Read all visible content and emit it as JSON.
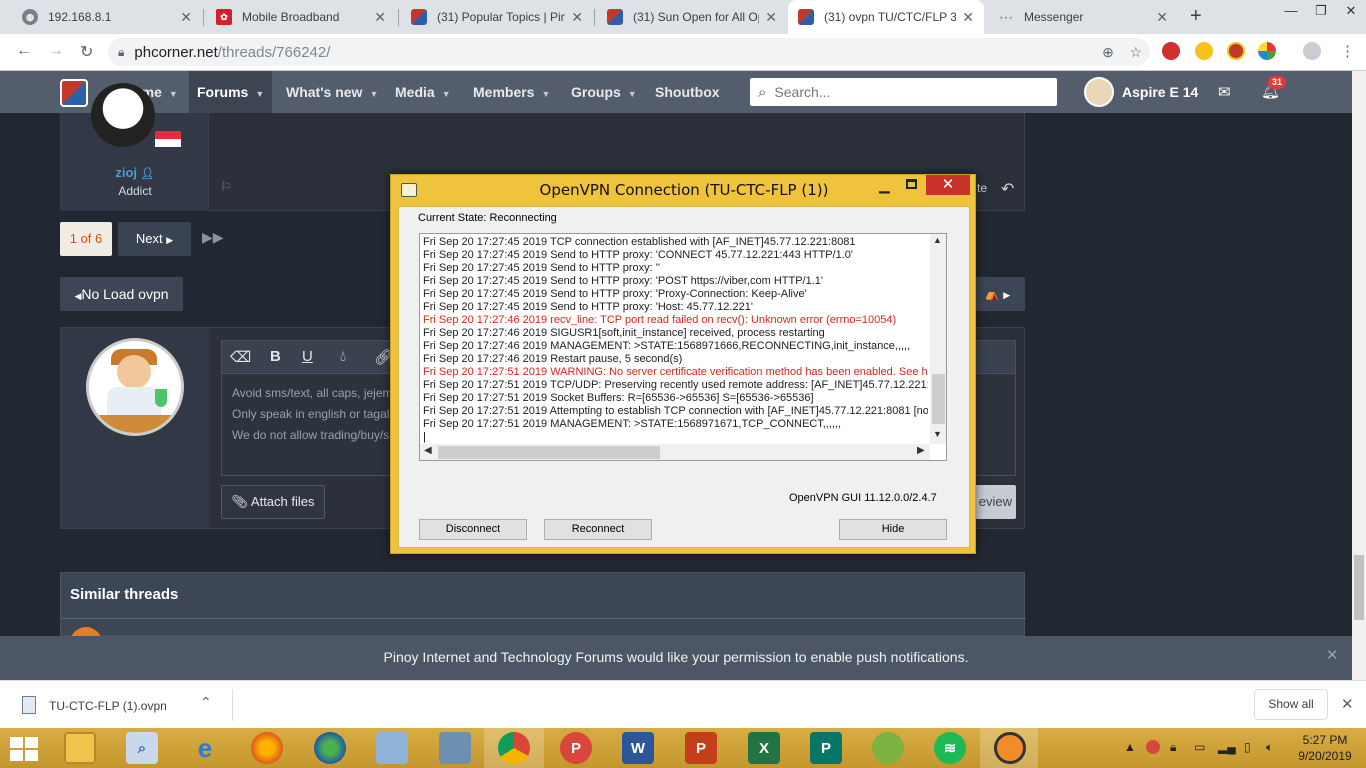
{
  "browser": {
    "tabs": [
      {
        "title": "192.168.8.1",
        "close": "✕"
      },
      {
        "title": "Mobile Broadband",
        "close": "✕"
      },
      {
        "title": "(31) Popular Topics | Pinc",
        "close": "✕"
      },
      {
        "title": "(31) Sun Open for All Op",
        "close": "✕"
      },
      {
        "title": "(31) ovpn TU/CTC/FLP 3",
        "close": "✕"
      },
      {
        "title": "Messenger",
        "close": "✕"
      }
    ],
    "new_tab": "+",
    "window_buttons": {
      "minimize": "—",
      "maximize": "❐",
      "close": "✕"
    },
    "address": {
      "host": "phcorner.net",
      "path": "/threads/766242/"
    }
  },
  "forum": {
    "nav": [
      {
        "label": "Home"
      },
      {
        "label": "Forums"
      },
      {
        "label": "What's new"
      },
      {
        "label": "Media"
      },
      {
        "label": "Members"
      },
      {
        "label": "Groups"
      },
      {
        "label": "Shoutbox"
      }
    ],
    "search_placeholder": "Search...",
    "user": {
      "name": "Aspire E 14",
      "alert_count": "31"
    },
    "post": {
      "author": "zioj",
      "role": "Addict",
      "action_fragment": "te"
    },
    "pagination": {
      "current": "1 of 6",
      "next": "Next"
    },
    "no_load_button": "No Load ovpn",
    "editor": {
      "placeholder_lines": [
        "Avoid sms/text, all caps, jejem",
        "Only speak in english or tagalo",
        "We do not allow trading/buy/s"
      ],
      "attach_label": "Attach files",
      "preview_fragment": "eview"
    },
    "similar_threads_title": "Similar threads",
    "push_notice": "Pinoy Internet and Technology Forums would like your permission to enable push notifications."
  },
  "vpn_dialog": {
    "title": "OpenVPN Connection (TU-CTC-FLP (1))",
    "current_state": "Current State: Reconnecting",
    "log": [
      {
        "text": "Fri Sep 20 17:27:45 2019 TCP connection established with [AF_INET]45.77.12.221:8081",
        "level": "info"
      },
      {
        "text": "Fri Sep 20 17:27:45 2019 Send to HTTP proxy: 'CONNECT 45.77.12.221:443 HTTP/1.0'",
        "level": "info"
      },
      {
        "text": "Fri Sep 20 17:27:45 2019 Send to HTTP proxy: ''",
        "level": "info"
      },
      {
        "text": "Fri Sep 20 17:27:45 2019 Send to HTTP proxy: 'POST https://viber,com HTTP/1.1'",
        "level": "info"
      },
      {
        "text": "Fri Sep 20 17:27:45 2019 Send to HTTP proxy: 'Proxy-Connection: Keep-Alive'",
        "level": "info"
      },
      {
        "text": "Fri Sep 20 17:27:45 2019 Send to HTTP proxy: 'Host: 45.77.12.221'",
        "level": "info"
      },
      {
        "text": "Fri Sep 20 17:27:46 2019 recv_line: TCP port read failed on recv(): Unknown error (errno=10054)",
        "level": "error"
      },
      {
        "text": "Fri Sep 20 17:27:46 2019 SIGUSR1[soft,init_instance] received, process restarting",
        "level": "info"
      },
      {
        "text": "Fri Sep 20 17:27:46 2019 MANAGEMENT: >STATE:1568971666,RECONNECTING,init_instance,,,,,",
        "level": "info"
      },
      {
        "text": "Fri Sep 20 17:27:46 2019 Restart pause, 5 second(s)",
        "level": "info"
      },
      {
        "text": "Fri Sep 20 17:27:51 2019 WARNING: No server certificate verification method has been enabled.  See http",
        "level": "error"
      },
      {
        "text": "Fri Sep 20 17:27:51 2019 TCP/UDP: Preserving recently used remote address: [AF_INET]45.77.12.221:808",
        "level": "info"
      },
      {
        "text": "Fri Sep 20 17:27:51 2019 Socket Buffers: R=[65536->65536] S=[65536->65536]",
        "level": "info"
      },
      {
        "text": "Fri Sep 20 17:27:51 2019 Attempting to establish TCP connection with [AF_INET]45.77.12.221:8081 [nonbl",
        "level": "info"
      },
      {
        "text": "Fri Sep 20 17:27:51 2019 MANAGEMENT: >STATE:1568971671,TCP_CONNECT,,,,,,",
        "level": "info"
      },
      {
        "text": "|",
        "level": "cursor"
      }
    ],
    "version": "OpenVPN GUI 11.12.0.0/2.4.7",
    "buttons": {
      "disconnect": "Disconnect",
      "reconnect": "Reconnect",
      "hide": "Hide"
    }
  },
  "downloads": {
    "filename": "TU-CTC-FLP (1).ovpn",
    "show_all": "Show all"
  },
  "taskbar": {
    "apps": [
      "file-explorer",
      "search",
      "internet-explorer",
      "firefox",
      "network",
      "control-panel",
      "remote",
      "chrome",
      "psiphon",
      "word",
      "powerpoint",
      "excel",
      "publisher",
      "android",
      "spotify",
      "openvpn"
    ],
    "clock_time": "5:27 PM",
    "clock_date": "9/20/2019"
  },
  "colors": {
    "forum_header": "#545d6b",
    "vpn_frame": "#f0c33c",
    "log_error": "#d7271f",
    "taskbar": "#c9a035"
  }
}
